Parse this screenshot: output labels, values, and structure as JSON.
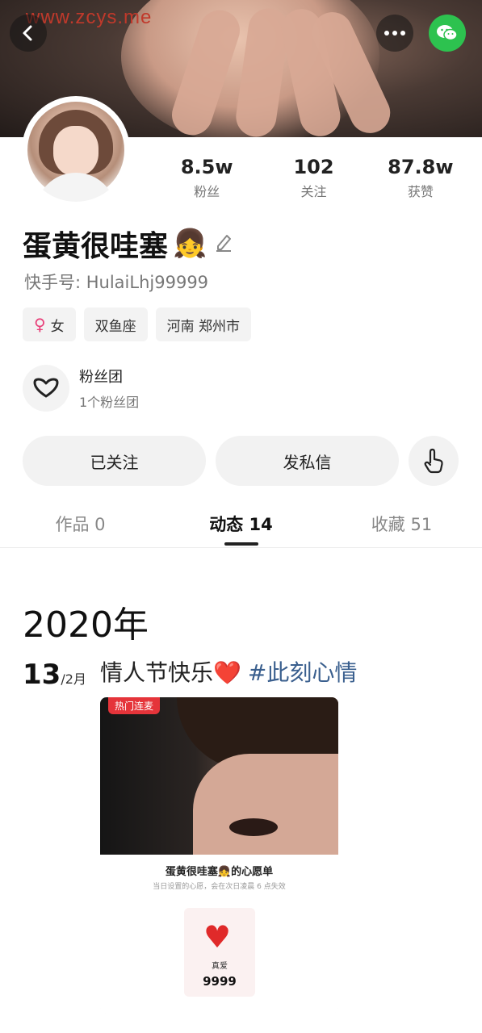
{
  "watermark": "www.zcys.me",
  "profile": {
    "name": "蛋黄很哇塞",
    "name_emoji": "👧",
    "uid": "快手号: HulaiLhj99999"
  },
  "stats": [
    {
      "value": "8.5w",
      "label": "粉丝"
    },
    {
      "value": "102",
      "label": "关注"
    },
    {
      "value": "87.8w",
      "label": "获赞"
    }
  ],
  "tags": {
    "gender": "女",
    "zodiac": "双鱼座",
    "location": "河南 郑州市"
  },
  "fan_group": {
    "title": "粉丝团",
    "subtitle": "1个粉丝团"
  },
  "actions": {
    "follow_label": "已关注",
    "message_label": "发私信"
  },
  "tabs": [
    {
      "label": "作品 0",
      "active": false
    },
    {
      "label": "动态 14",
      "active": true
    },
    {
      "label": "收藏 51",
      "active": false
    }
  ],
  "timeline": {
    "year": "2020年",
    "post": {
      "day": "13",
      "month": "/2月",
      "text": "情人节快乐",
      "heart": "❤️",
      "hashtag": "#此刻心情",
      "card": {
        "badge": "热门连麦",
        "wish_title": "蛋黄很哇塞👧的心愿单",
        "wish_subtitle": "当日设置的心愿，会在次日凌晨 6 点失效",
        "gift_name": "真爱",
        "gift_count": "9999"
      }
    }
  },
  "icons": {
    "back": "chevron-left-icon",
    "more": "more-dots-icon",
    "wechat": "wechat-icon",
    "edit": "pencil-icon",
    "fans": "heart-outline-icon",
    "touch": "hand-pointer-icon"
  },
  "colors": {
    "wechat_green": "#2dc24f",
    "hashtag_blue": "#3a5f8e",
    "venus_pink": "#e8417a",
    "hot_red": "#e5343a"
  }
}
